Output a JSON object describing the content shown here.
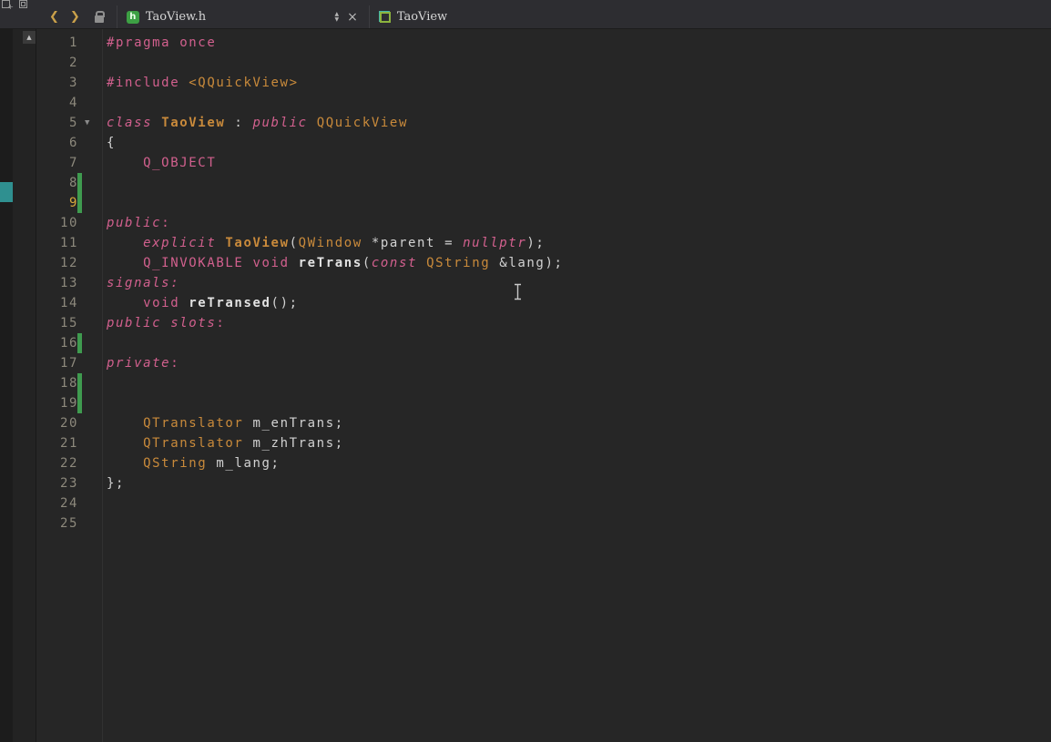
{
  "toolbar": {
    "back_icon": "❮",
    "forward_icon": "❯",
    "tab": {
      "filename": "TaoView.h",
      "file_badge": "h",
      "arrow_up": "▲",
      "arrow_down": "▼",
      "close_icon": "×"
    },
    "symbol": {
      "label": "TaoView"
    }
  },
  "icons": {
    "scroll_up": "▲",
    "fold": "▼"
  },
  "gutter": {
    "total_lines": 25,
    "current_line": 9,
    "added_lines": [
      8,
      9,
      16,
      18,
      19
    ],
    "fold_line": 5
  },
  "code": {
    "language": "cpp",
    "lines": [
      [
        {
          "s": "pp",
          "t": "#pragma once"
        }
      ],
      [],
      [
        {
          "s": "pp",
          "t": "#include "
        },
        {
          "s": "orange",
          "t": "<QQuickView>"
        }
      ],
      [],
      [
        {
          "s": "kwi",
          "t": "class "
        },
        {
          "s": "cls",
          "t": "TaoView"
        },
        {
          "s": "pl",
          "t": " : "
        },
        {
          "s": "kwi",
          "t": "public "
        },
        {
          "s": "type",
          "t": "QQuickView"
        }
      ],
      [
        {
          "s": "pl",
          "t": "{"
        }
      ],
      [
        {
          "s": "pl",
          "t": "    "
        },
        {
          "s": "kw",
          "t": "Q_OBJECT"
        }
      ],
      [],
      [],
      [
        {
          "s": "kwi",
          "t": "public"
        },
        {
          "s": "kw",
          "t": ":"
        }
      ],
      [
        {
          "s": "pl",
          "t": "    "
        },
        {
          "s": "kwi",
          "t": "explicit "
        },
        {
          "s": "cls",
          "t": "TaoView"
        },
        {
          "s": "pl",
          "t": "("
        },
        {
          "s": "type",
          "t": "QWindow"
        },
        {
          "s": "pl",
          "t": " *parent = "
        },
        {
          "s": "kwi",
          "t": "nullptr"
        },
        {
          "s": "pl",
          "t": ");"
        }
      ],
      [
        {
          "s": "pl",
          "t": "    "
        },
        {
          "s": "kw",
          "t": "Q_INVOKABLE"
        },
        {
          "s": "kw",
          "t": " void "
        },
        {
          "s": "fn",
          "t": "reTrans"
        },
        {
          "s": "pl",
          "t": "("
        },
        {
          "s": "kwi",
          "t": "const "
        },
        {
          "s": "type",
          "t": "QString"
        },
        {
          "s": "pl",
          "t": " &lang);"
        }
      ],
      [
        {
          "s": "kwi",
          "t": "signals:"
        }
      ],
      [
        {
          "s": "pl",
          "t": "    "
        },
        {
          "s": "kw",
          "t": "void "
        },
        {
          "s": "fn",
          "t": "reTransed"
        },
        {
          "s": "pl",
          "t": "();"
        }
      ],
      [
        {
          "s": "kwi",
          "t": "public slots"
        },
        {
          "s": "kw",
          "t": ":"
        }
      ],
      [],
      [
        {
          "s": "kwi",
          "t": "private"
        },
        {
          "s": "kw",
          "t": ":"
        }
      ],
      [],
      [],
      [
        {
          "s": "pl",
          "t": "    "
        },
        {
          "s": "type",
          "t": "QTranslator"
        },
        {
          "s": "pl",
          "t": " m_enTrans;"
        }
      ],
      [
        {
          "s": "pl",
          "t": "    "
        },
        {
          "s": "type",
          "t": "QTranslator"
        },
        {
          "s": "pl",
          "t": " m_zhTrans;"
        }
      ],
      [
        {
          "s": "pl",
          "t": "    "
        },
        {
          "s": "type",
          "t": "QString"
        },
        {
          "s": "pl",
          "t": " m_lang;"
        }
      ],
      [
        {
          "s": "pl",
          "t": "};"
        }
      ],
      [],
      []
    ]
  },
  "colors": {
    "keyword_pink": "#d2608e",
    "type_orange": "#c98a3b",
    "plain_text": "#d2d2d2",
    "line_number": "#8d897c",
    "line_number_current": "#d9a93c",
    "vcs_added_green": "#3f9b4f",
    "scroll_marker_teal": "#2f9090",
    "editor_background": "#262626"
  }
}
